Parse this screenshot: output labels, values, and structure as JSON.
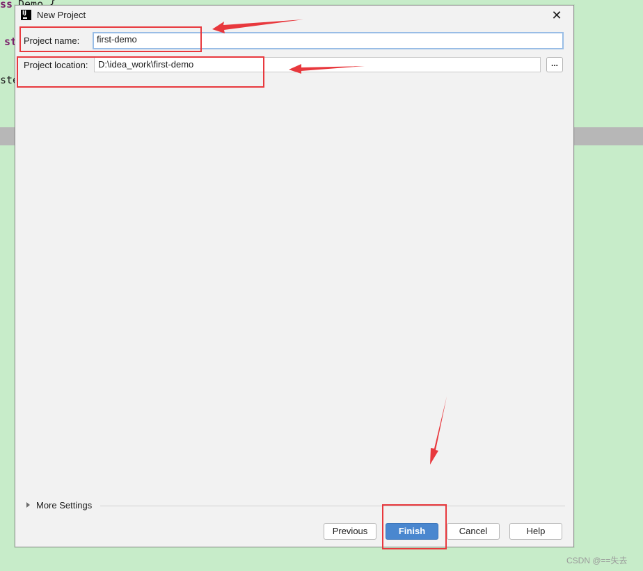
{
  "background": {
    "code_fragments": [
      "ss",
      "Demo {",
      "st",
      "ste"
    ]
  },
  "dialog": {
    "title": "New Project",
    "app_icon_label": "IJ",
    "close_glyph": "✕",
    "project_name_label": "Project name:",
    "project_name_value": "first-demo",
    "project_location_label": "Project location:",
    "project_location_value": "D:\\idea_work\\first-demo",
    "browse_label": "...",
    "more_settings_label": "More Settings",
    "buttons": {
      "previous": "Previous",
      "finish": "Finish",
      "cancel": "Cancel",
      "help": "Help"
    }
  },
  "watermark": "CSDN @==失去",
  "colors": {
    "background": "#c7ecc9",
    "annotation_red": "#e8383d",
    "primary_button": "#4a87cf"
  }
}
